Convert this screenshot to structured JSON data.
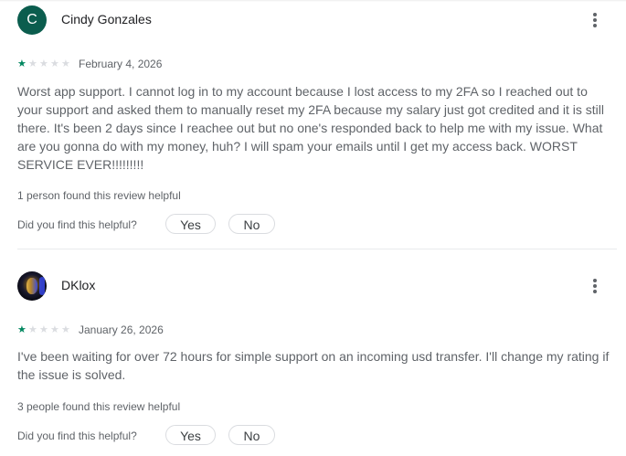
{
  "reviews": [
    {
      "author": "Cindy Gonzales",
      "avatar_letter": "C",
      "avatar_color": "#0b5d4e",
      "rating": 1,
      "rating_max": 5,
      "date": "February 4, 2026",
      "text": "Worst app support. I cannot log in to my account because I lost access to my 2FA so I reached out to your support and asked them to manually reset my 2FA because my salary just got credited and it is still there. It's been 2 days since I reachee out but no one's responded back to help me with my issue. What are you gonna do with my money, huh? I will spam your emails until I get my access back. WORST SERVICE EVER!!!!!!!!!",
      "helpful_count_text": "1 person found this review helpful",
      "helpful_question": "Did you find this helpful?",
      "yes_label": "Yes",
      "no_label": "No",
      "more_icon": "more-vertical-icon"
    },
    {
      "author": "DKlox",
      "avatar_image": "profile photo",
      "rating": 1,
      "rating_max": 5,
      "date": "January 26, 2026",
      "text": "I've been waiting for over 72 hours for simple support on an incoming usd transfer. I'll change my rating if the issue is solved.",
      "helpful_count_text": "3 people found this review helpful",
      "helpful_question": "Did you find this helpful?",
      "yes_label": "Yes",
      "no_label": "No",
      "more_icon": "more-vertical-icon"
    }
  ],
  "colors": {
    "star_filled": "#01875f",
    "star_empty": "#dadce0",
    "text_secondary": "#5f6368"
  }
}
